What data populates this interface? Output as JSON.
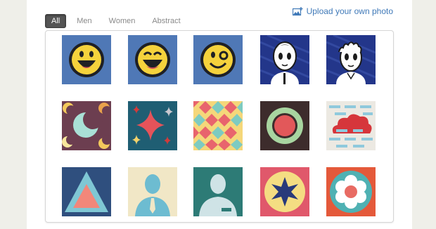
{
  "tabs": [
    {
      "label": "All",
      "active": true
    },
    {
      "label": "Men",
      "active": false
    },
    {
      "label": "Women",
      "active": false
    },
    {
      "label": "Abstract",
      "active": false
    }
  ],
  "upload": {
    "label": "Upload your own photo",
    "icon": "add-photo-icon"
  },
  "avatars": [
    {
      "name": "smiley-grin",
      "row": 1,
      "col": 1
    },
    {
      "name": "smiley-laugh",
      "row": 1,
      "col": 2
    },
    {
      "name": "smiley-wink",
      "row": 1,
      "col": 3
    },
    {
      "name": "cartoon-man-sketch",
      "row": 1,
      "col": 4
    },
    {
      "name": "cartoon-man-curly",
      "row": 1,
      "col": 5
    },
    {
      "name": "moon-pattern",
      "row": 2,
      "col": 1
    },
    {
      "name": "star-sparkles",
      "row": 2,
      "col": 2
    },
    {
      "name": "diamond-checker",
      "row": 2,
      "col": 3
    },
    {
      "name": "ring-target",
      "row": 2,
      "col": 4
    },
    {
      "name": "cloud-bricks",
      "row": 2,
      "col": 5
    },
    {
      "name": "triangle",
      "row": 3,
      "col": 1
    },
    {
      "name": "silhouette-tie",
      "row": 3,
      "col": 2
    },
    {
      "name": "silhouette-badge",
      "row": 3,
      "col": 3
    },
    {
      "name": "star-flower",
      "row": 3,
      "col": 4
    },
    {
      "name": "flower",
      "row": 3,
      "col": 5
    }
  ],
  "colors": {
    "accent": "#3f79b8",
    "activeTab": "#555555"
  }
}
